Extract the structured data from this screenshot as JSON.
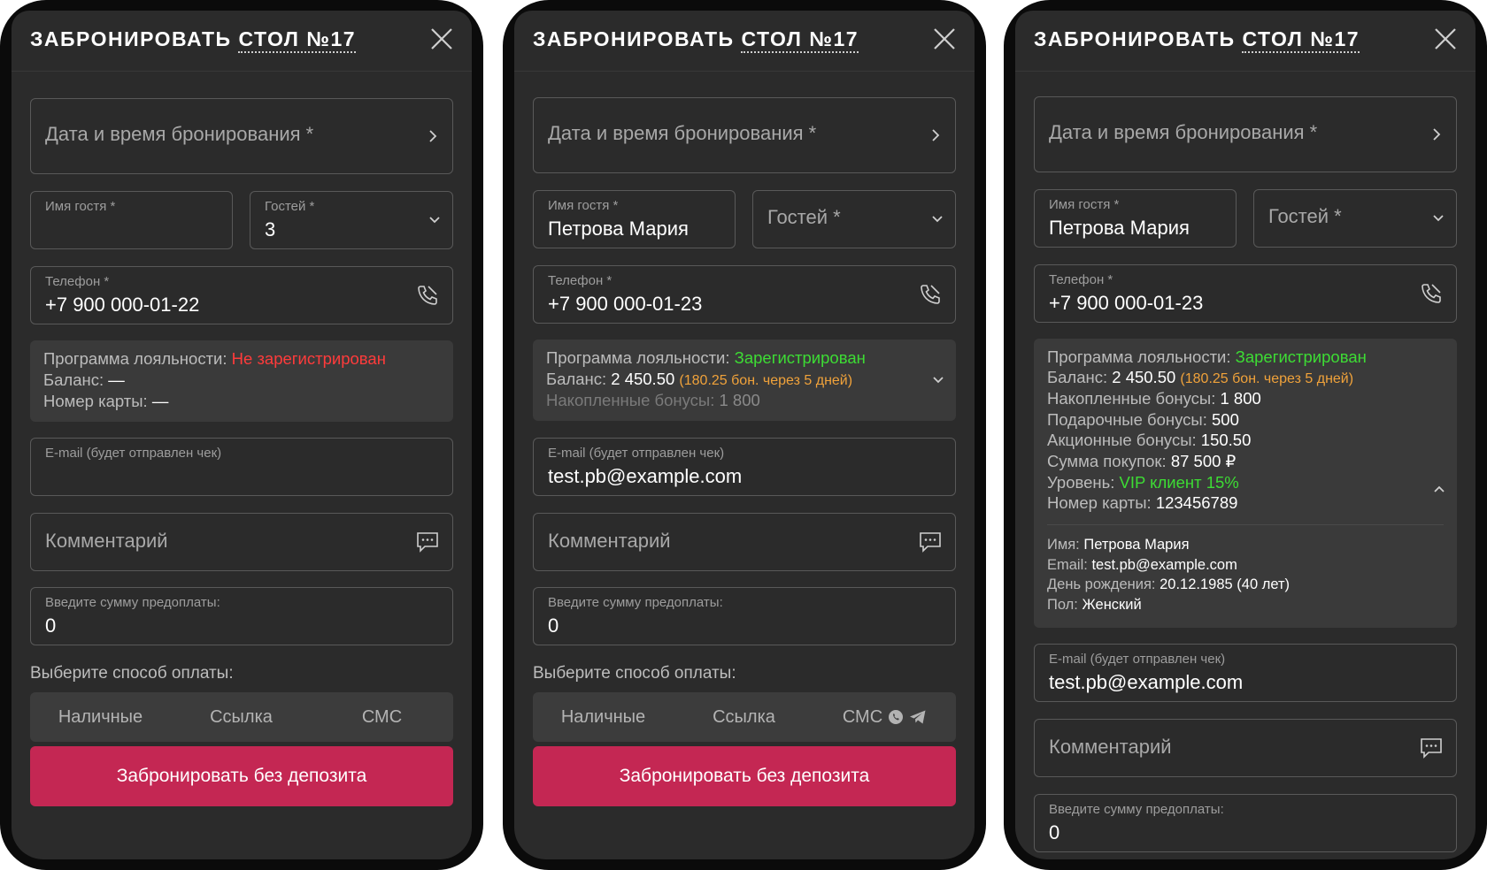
{
  "colors": {
    "accent": "#c42753",
    "success": "#3ddc34",
    "error": "#ff3b3b",
    "bonus": "#f0a23a"
  },
  "screens": [
    {
      "title_prefix": "ЗАБРОНИРОВАТЬ",
      "title_table": "СТОЛ №17",
      "datetime_placeholder": "Дата и время бронирования *",
      "guest_name": {
        "label": "Имя гостя *",
        "value": ""
      },
      "guests": {
        "label": "Гостей *",
        "value": "3"
      },
      "phone": {
        "label": "Телефон *",
        "value": "+7 900 000-01-22"
      },
      "loyalty": {
        "label": "Программа лояльности:",
        "status": "Не зарегистрирован",
        "balance_label": "Баланс:",
        "balance_value": "—",
        "card_label": "Номер карты:",
        "card_value": "—"
      },
      "email": {
        "label": "E-mail (будет отправлен чек)",
        "value": ""
      },
      "comment_placeholder": "Комментарий",
      "prepay": {
        "label": "Введите сумму предоплаты:",
        "value": "0"
      },
      "pay_method_label": "Выберите способ оплаты:",
      "pay_methods": [
        "Наличные",
        "Ссылка",
        "СМС"
      ],
      "book_button": "Забронировать без депозита"
    },
    {
      "title_prefix": "ЗАБРОНИРОВАТЬ",
      "title_table": "СТОЛ №17",
      "datetime_placeholder": "Дата и время бронирования *",
      "guest_name": {
        "label": "Имя гостя *",
        "value": "Петрова Мария"
      },
      "guests_placeholder": "Гостей *",
      "phone": {
        "label": "Телефон *",
        "value": "+7 900 000-01-23"
      },
      "loyalty": {
        "label": "Программа лояльности:",
        "status": "Зарегистрирован",
        "balance_label": "Баланс:",
        "balance_value": "2 450.50",
        "balance_pending": "(180.25 бон. через 5 дней)",
        "accum_label": "Накопленные бонусы:",
        "accum_value": "1 800"
      },
      "email": {
        "label": "E-mail (будет отправлен чек)",
        "value": "test.pb@example.com"
      },
      "comment_placeholder": "Комментарий",
      "prepay": {
        "label": "Введите сумму предоплаты:",
        "value": "0"
      },
      "pay_method_label": "Выберите способ оплаты:",
      "pay_methods": [
        "Наличные",
        "Ссылка",
        "СМС"
      ],
      "book_button": "Забронировать без депозита"
    },
    {
      "title_prefix": "ЗАБРОНИРОВАТЬ",
      "title_table": "СТОЛ №17",
      "datetime_placeholder": "Дата и время бронирования *",
      "guest_name": {
        "label": "Имя гостя *",
        "value": "Петрова Мария"
      },
      "guests_placeholder": "Гостей *",
      "phone": {
        "label": "Телефон *",
        "value": "+7 900 000-01-23"
      },
      "loyalty": {
        "label": "Программа лояльности:",
        "status": "Зарегистрирован",
        "balance_label": "Баланс:",
        "balance_value": "2 450.50",
        "balance_pending": "(180.25 бон. через 5 дней)",
        "accum_label": "Накопленные бонусы:",
        "accum_value": "1 800",
        "gift_label": "Подарочные бонусы:",
        "gift_value": "500",
        "promo_label": "Акционные бонусы:",
        "promo_value": "150.50",
        "purchases_label": "Сумма покупок:",
        "purchases_value": "87 500 ₽",
        "level_label": "Уровень:",
        "level_value": "VIP клиент 15%",
        "card_label": "Номер карты:",
        "card_value": "123456789",
        "name_label": "Имя:",
        "name_value": "Петрова Мария",
        "email_label": "Email:",
        "email_value": "test.pb@example.com",
        "birthday_label": "День рождения:",
        "birthday_value": "20.12.1985 (40 лет)",
        "gender_label": "Пол:",
        "gender_value": "Женский"
      },
      "email": {
        "label": "E-mail (будет отправлен чек)",
        "value": "test.pb@example.com"
      },
      "comment_placeholder": "Комментарий",
      "prepay": {
        "label": "Введите сумму предоплаты:",
        "value": "0"
      }
    }
  ]
}
